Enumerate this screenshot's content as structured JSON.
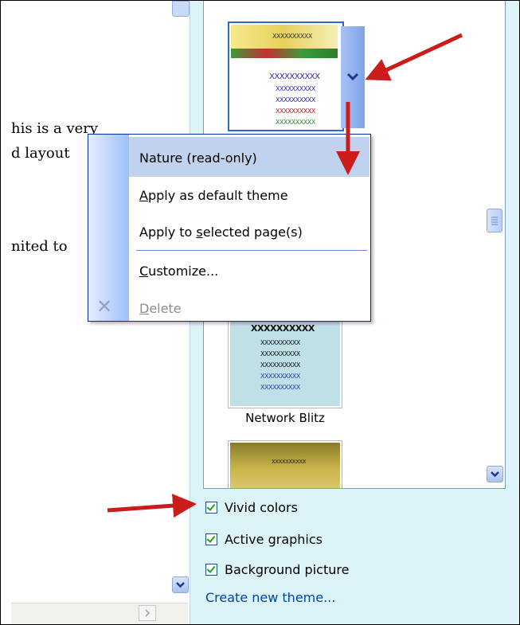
{
  "document": {
    "lines": [
      "his is a very",
      "d layout",
      "nited to"
    ]
  },
  "gallery": {
    "themes": [
      {
        "name": "Nature"
      },
      {
        "name": "Network Blitz"
      }
    ],
    "placeholder_text": "XXXXXXXXXX"
  },
  "context_menu": {
    "items": [
      {
        "label": "Nature (read-only)",
        "highlighted": true,
        "enabled": true
      },
      {
        "label_pre": "",
        "label_acc": "A",
        "label_post": "pply as default theme",
        "enabled": true
      },
      {
        "label_pre": "Apply to ",
        "label_acc": "s",
        "label_post": "elected page(s)",
        "enabled": true
      },
      {
        "label_pre": "",
        "label_acc": "C",
        "label_post": "ustomize...",
        "enabled": true
      },
      {
        "label_pre": "",
        "label_acc": "D",
        "label_post": "elete",
        "enabled": false
      }
    ]
  },
  "options": {
    "vivid_colors": {
      "label": "Vivid colors",
      "checked": true
    },
    "active_graphics": {
      "label": "Active graphics",
      "checked": true
    },
    "background_picture": {
      "label": "Background picture",
      "checked": true
    }
  },
  "create_link": "Create new theme...",
  "colors": {
    "annotation_arrow": "#cc1b1b",
    "menu_highlight": "#c1d2ee",
    "pane_bg": "#dcf3f8",
    "link": "#0044aa"
  },
  "icons": [
    "chevron-down-icon",
    "delete-x-icon",
    "checkmark-icon",
    "scroll-grip-icon"
  ]
}
